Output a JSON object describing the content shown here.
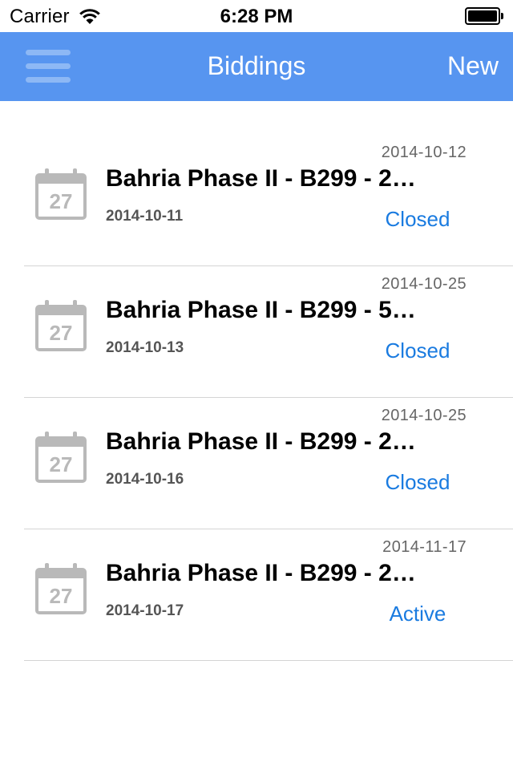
{
  "status_bar": {
    "carrier": "Carrier",
    "time": "6:28 PM"
  },
  "nav": {
    "title": "Biddings",
    "new_label": "New",
    "bar_color": "#5795f0"
  },
  "biddings": [
    {
      "title": "Bahria Phase II - B299 - 2…",
      "start_date": "2014-10-11",
      "end_date": "2014-10-12",
      "status": "Closed",
      "icon_day": "27"
    },
    {
      "title": "Bahria Phase II - B299 - 5…",
      "start_date": "2014-10-13",
      "end_date": "2014-10-25",
      "status": "Closed",
      "icon_day": "27"
    },
    {
      "title": "Bahria Phase II - B299 - 2…",
      "start_date": "2014-10-16",
      "end_date": "2014-10-25",
      "status": "Closed",
      "icon_day": "27"
    },
    {
      "title": "Bahria Phase II - B299 - 2…",
      "start_date": "2014-10-17",
      "end_date": "2014-11-17",
      "status": "Active",
      "icon_day": "27"
    }
  ],
  "status_color": "#1a7be0",
  "icons": {
    "menu": "hamburger-menu-icon",
    "row": "calendar-icon",
    "wifi": "wifi-icon",
    "battery": "battery-icon"
  }
}
